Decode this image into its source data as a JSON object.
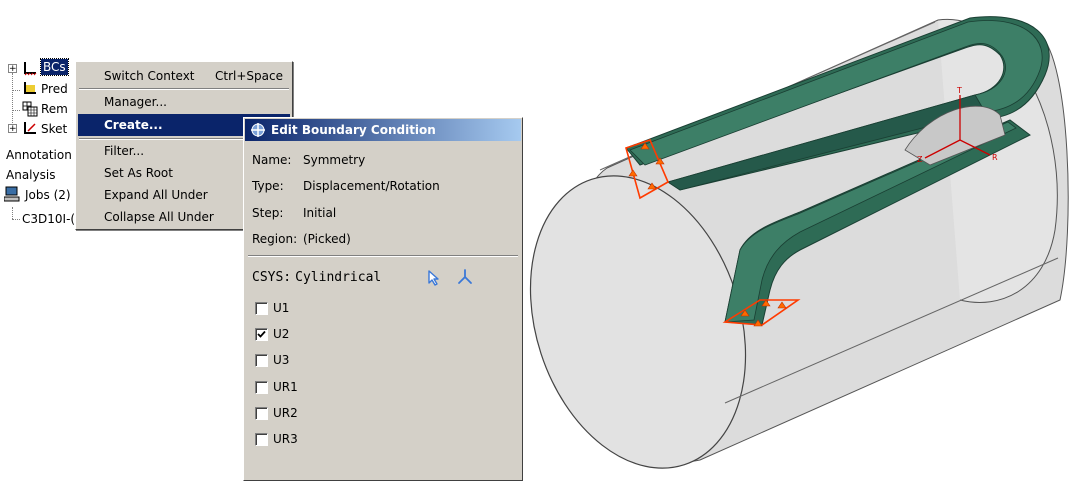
{
  "tree": {
    "bcs_label": "BCs",
    "pred_label": "Pred",
    "rem_label": "Rem",
    "sket_label": "Sket",
    "annotation_label": "Annotation",
    "analysis_label": "Analysis",
    "jobs_label": "Jobs (2)",
    "job_item_label": "C3D10I-("
  },
  "context_menu": {
    "items": [
      {
        "label": "Switch Context",
        "accel": "Ctrl+Space"
      },
      {
        "label": "Manager..."
      },
      {
        "label": "Create...",
        "selected": true
      },
      {
        "label": "Filter..."
      },
      {
        "label": "Set As Root"
      },
      {
        "label": "Expand All Under"
      },
      {
        "label": "Collapse All Under"
      }
    ]
  },
  "dialog": {
    "title": "Edit Boundary Condition",
    "fields": {
      "name_key": "Name:",
      "name_value": "Symmetry",
      "type_key": "Type:",
      "type_value": "Displacement/Rotation",
      "step_key": "Step:",
      "step_value": "Initial",
      "region_key": "Region:",
      "region_value": "(Picked)"
    },
    "csys_key": "CSYS:",
    "csys_value": "Cylindrical",
    "dofs": [
      {
        "label": "U1",
        "checked": false
      },
      {
        "label": "U2",
        "checked": true
      },
      {
        "label": "U3",
        "checked": false
      },
      {
        "label": "UR1",
        "checked": false
      },
      {
        "label": "UR2",
        "checked": false
      },
      {
        "label": "UR3",
        "checked": false
      }
    ]
  },
  "viewport": {
    "triad": {
      "r": "R",
      "t": "T",
      "z": "Z"
    },
    "colors": {
      "cylinder": "#d8d8d8",
      "channel": "#2e6b55",
      "bc_markers": "#ff4500",
      "triad": "#cc0000"
    }
  }
}
